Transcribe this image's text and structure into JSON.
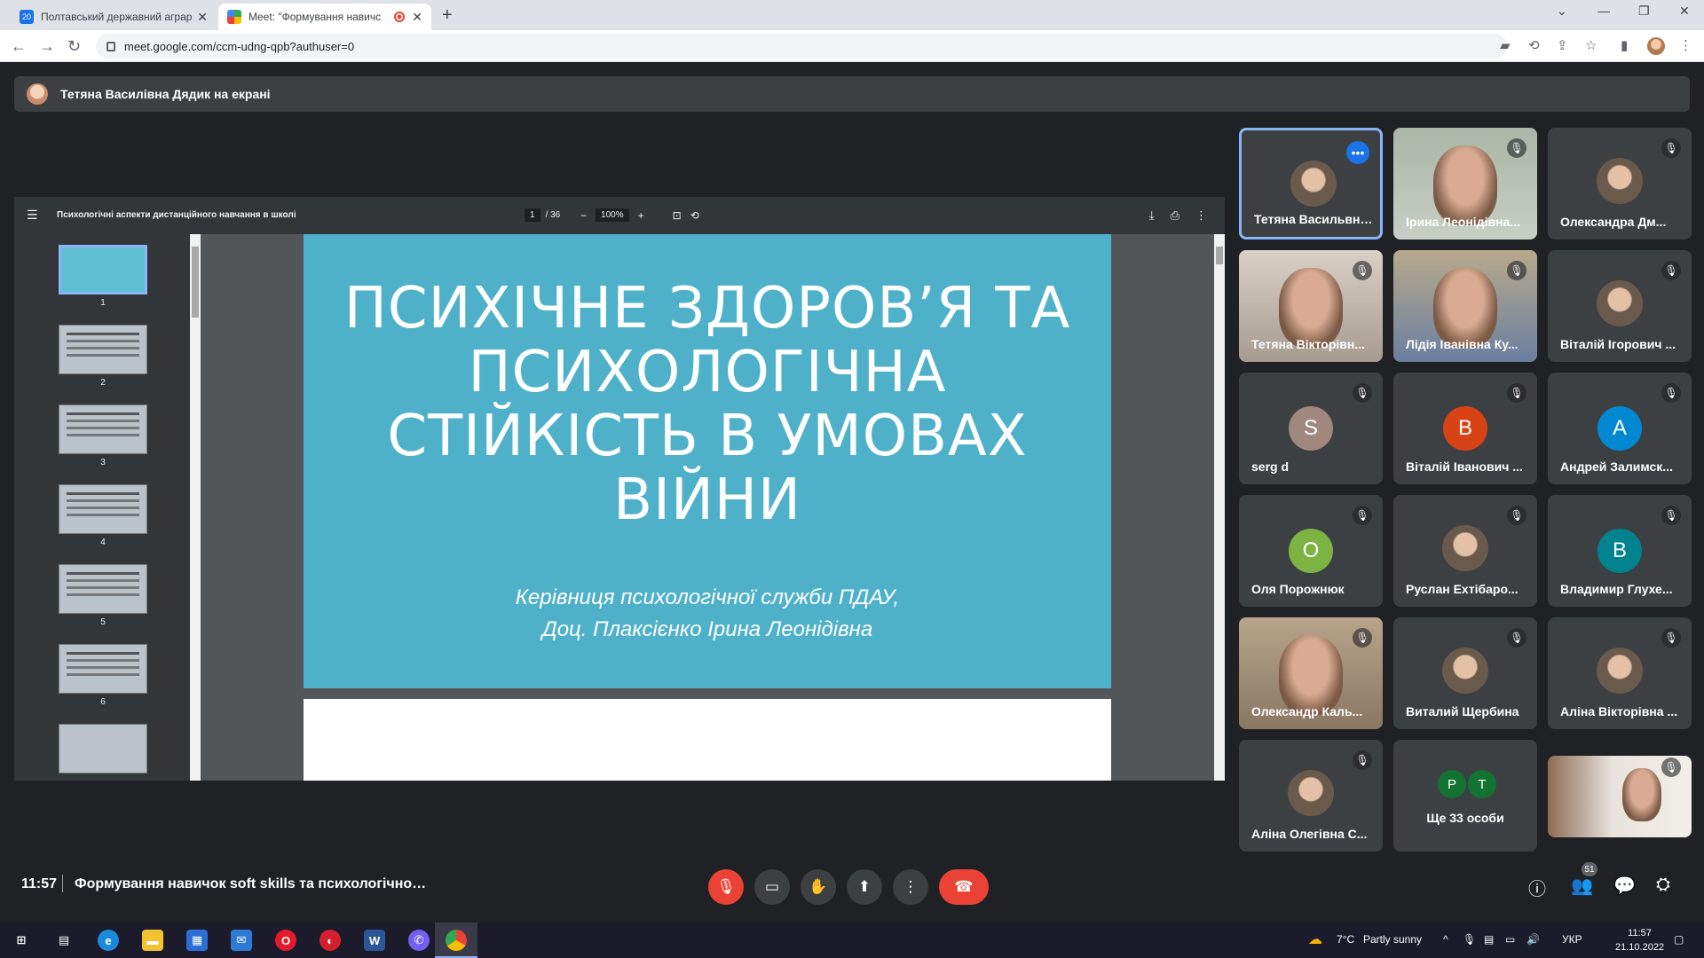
{
  "browser": {
    "tabs": [
      {
        "label": "Полтавський державний аграр",
        "icon": "pdau-favicon",
        "active": false
      },
      {
        "label": "Meet: \"Формування навичс",
        "icon": "meet-favicon",
        "active": true,
        "recording": true
      }
    ],
    "url": "meet.google.com/ccm-udng-qpb?authuser=0"
  },
  "presenter_banner": {
    "text": "Тетяна Василівна Дядик на екрані"
  },
  "pdf_viewer": {
    "doc_title": "Психологічні аспекти дистанційного навчання в школі",
    "page_current": "1",
    "page_total": "/ 36",
    "zoom": "100%",
    "thumbnails": [
      "1",
      "2",
      "3",
      "4",
      "5",
      "6"
    ],
    "slide": {
      "title": "ПСИХІЧНЕ ЗДОРОВ’Я ТА ПСИХОЛОГІЧНА СТІЙКІСТЬ  В УМОВАХ ВІЙНИ",
      "subtitle_line1": "Керівниця психологічної служби ПДАУ,",
      "subtitle_line2": "Доц. Плаксієнко Ірина Леонідівна",
      "bg_color": "#4fb1c9"
    }
  },
  "participants": [
    {
      "name": "Тетяна Васильвна...",
      "type": "photo-avatar",
      "speaking": true
    },
    {
      "name": "Ірина Леонідівна...",
      "type": "camera"
    },
    {
      "name": "Олександра Дм...",
      "type": "photo-avatar"
    },
    {
      "name": "Тетяна Вікторівн...",
      "type": "camera"
    },
    {
      "name": "Лідія Іванівна Ку...",
      "type": "camera"
    },
    {
      "name": "Віталій Ігорович ...",
      "type": "photo-avatar"
    },
    {
      "name": "serg d",
      "type": "letter",
      "letter": "S",
      "color": "#a1887f"
    },
    {
      "name": "Віталій Іванович ...",
      "type": "letter",
      "letter": "В",
      "color": "#d84315"
    },
    {
      "name": "Андрей Залимск...",
      "type": "letter",
      "letter": "А",
      "color": "#0288d1"
    },
    {
      "name": "Оля Порожнюк",
      "type": "letter",
      "letter": "О",
      "color": "#7cb342"
    },
    {
      "name": "Руслан Ехтібаро...",
      "type": "photo-avatar"
    },
    {
      "name": "Владимир Глухе...",
      "type": "letter",
      "letter": "В",
      "color": "#00838f"
    },
    {
      "name": "Олександр Каль...",
      "type": "camera"
    },
    {
      "name": "Виталий Щербина",
      "type": "photo-avatar"
    },
    {
      "name": "Аліна Вікторівна ...",
      "type": "photo-avatar"
    },
    {
      "name": "Аліна Олегівна С...",
      "type": "photo-avatar"
    },
    {
      "name": "Ще 33 особи",
      "type": "more",
      "letters": [
        "P",
        "T"
      ]
    },
    {
      "name": "",
      "type": "self-camera"
    }
  ],
  "meeting_bar": {
    "time": "11:57",
    "title": "Формування навичок soft skills та психологічної с...",
    "participant_count": "51"
  },
  "taskbar": {
    "weather_temp": "7°C",
    "weather_text": "Partly sunny",
    "lang": "УКР",
    "time": "11:57",
    "date": "21.10.2022"
  },
  "colors": {
    "meet_bg": "#202124",
    "tile_bg": "#3c4043",
    "accent_blue": "#8ab4f8",
    "danger_red": "#ea4335"
  }
}
